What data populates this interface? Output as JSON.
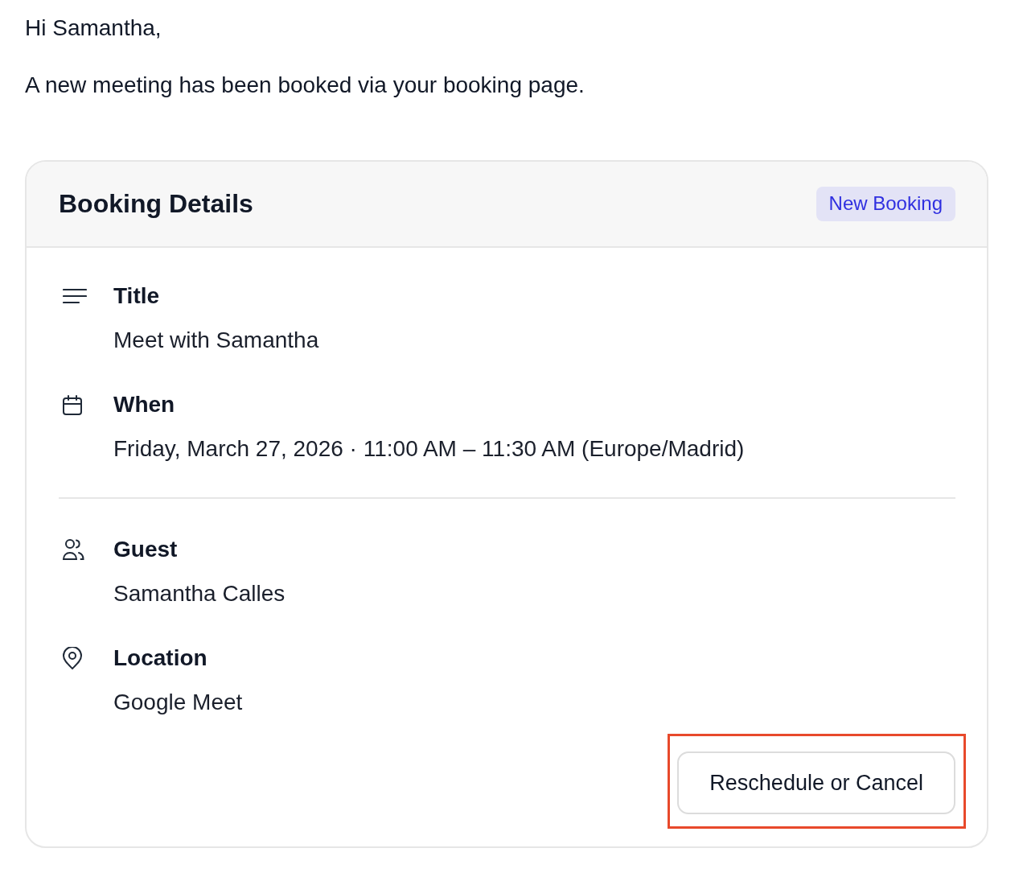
{
  "greeting": "Hi Samantha,",
  "intro": "A new meeting has been booked via your booking page.",
  "card": {
    "title": "Booking Details",
    "badge": "New Booking",
    "sections": [
      {
        "fields": [
          {
            "kind": "title",
            "label": "Title",
            "value": "Meet with Samantha"
          },
          {
            "kind": "when",
            "label": "When",
            "value": "Friday, March 27, 2026 · 11:00 AM – 11:30 AM (Europe/Madrid)"
          }
        ]
      },
      {
        "fields": [
          {
            "kind": "guest",
            "label": "Guest",
            "value": "Samantha Calles"
          },
          {
            "kind": "location",
            "label": "Location",
            "value": "Google Meet"
          }
        ]
      }
    ],
    "button": {
      "label": "Reschedule or Cancel",
      "highlighted": true
    }
  }
}
